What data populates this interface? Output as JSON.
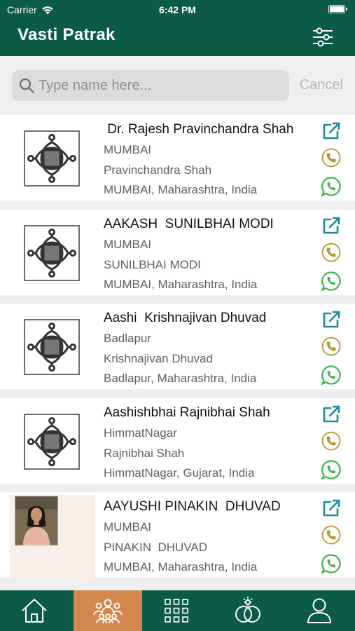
{
  "status": {
    "carrier": "Carrier",
    "time": "6:42 PM"
  },
  "nav": {
    "title": "Vasti Patrak",
    "filter_icon": "sliders-icon"
  },
  "search": {
    "placeholder": "Type name here...",
    "value": "",
    "cancel_label": "Cancel"
  },
  "colors": {
    "brand": "#0b5b45",
    "active_tab": "#d4884f",
    "link": "#1a8a9c",
    "phone": "#b8962e",
    "whatsapp": "#3cb64a"
  },
  "members": [
    {
      "name": " Dr. Rajesh Pravinchandra Shah",
      "city": "MUMBAI",
      "father": "Pravinchandra Shah",
      "address": "MUMBAI, Maharashtra, India",
      "photo": "placeholder-logo"
    },
    {
      "name": "AAKASH  SUNILBHAI MODI",
      "city": "MUMBAI",
      "father": "SUNILBHAI MODI",
      "address": "MUMBAI, Maharashtra, India",
      "photo": "placeholder-logo"
    },
    {
      "name": "Aashi  Krishnajivan Dhuvad",
      "city": "Badlapur",
      "father": "Krishnajivan Dhuvad",
      "address": "Badlapur, Maharashtra, India",
      "photo": "placeholder-logo"
    },
    {
      "name": "Aashishbhai Rajnibhai Shah",
      "city": "HimmatNagar",
      "father": "Rajnibhai Shah",
      "address": "HimmatNagar, Gujarat, India",
      "photo": "placeholder-logo"
    },
    {
      "name": "AAYUSHI PINAKIN  DHUVAD",
      "city": "MUMBAI",
      "father": "PINAKIN  DHUVAD",
      "address": "MUMBAI, Maharashtra, India",
      "photo": "person-photo"
    }
  ],
  "tabs": [
    {
      "icon": "home-icon",
      "active": false
    },
    {
      "icon": "community-icon",
      "active": true
    },
    {
      "icon": "grid-icon",
      "active": false
    },
    {
      "icon": "rings-icon",
      "active": false
    },
    {
      "icon": "profile-icon",
      "active": false
    }
  ]
}
